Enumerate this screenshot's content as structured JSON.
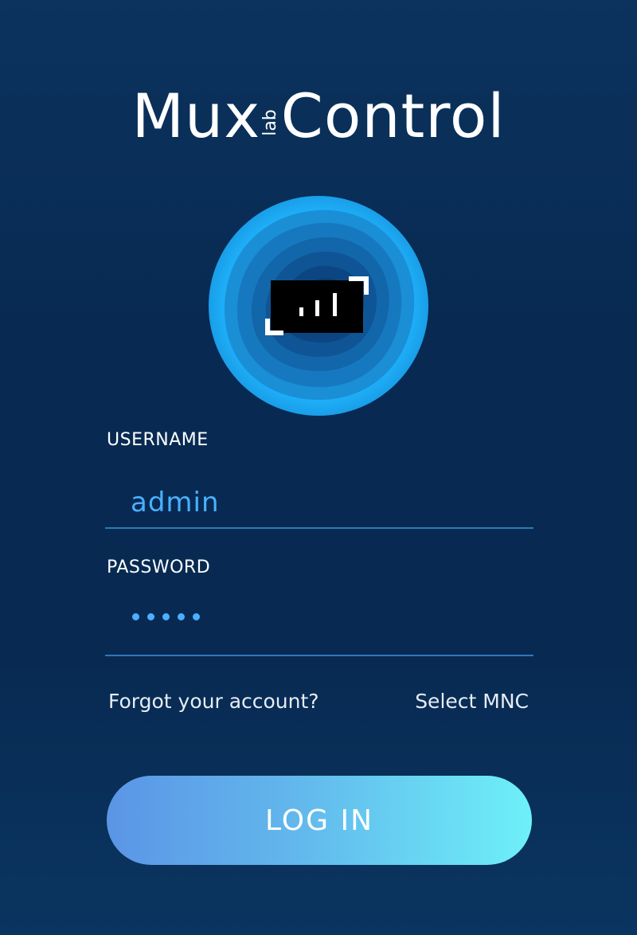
{
  "brand": {
    "name_left": "Mux",
    "name_small": "lab",
    "name_right": "Control"
  },
  "logo": {
    "icon": "signal-bars-icon"
  },
  "form": {
    "username_label": "USERNAME",
    "username_value": "admin",
    "password_label": "PASSWORD",
    "password_mask_count": 5
  },
  "links": {
    "forgot": "Forgot your account?",
    "select_mnc": "Select MNC"
  },
  "login_button": {
    "label": "LOG IN"
  },
  "colors": {
    "background": "#082a52",
    "accent": "#4ab0ff",
    "button_start": "#5b95e6",
    "button_end": "#6ef0f8",
    "input_underline": "#2a7ab8"
  }
}
